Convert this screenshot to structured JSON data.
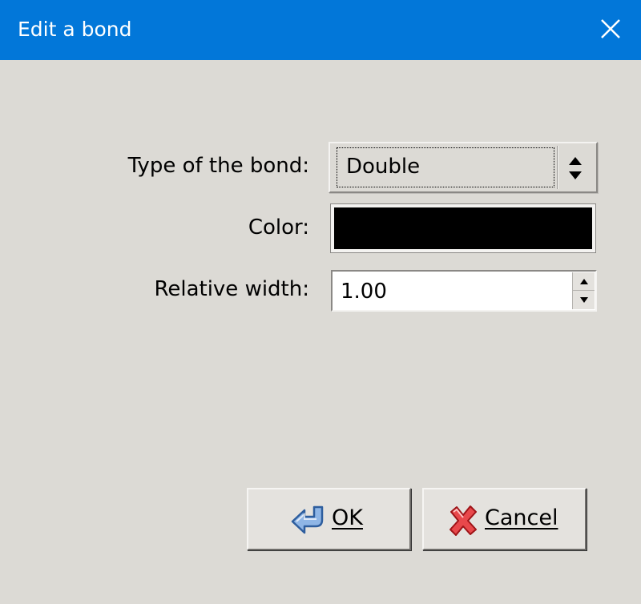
{
  "window": {
    "title": "Edit a bond",
    "close_icon": "close-icon"
  },
  "form": {
    "type_label": "Type of the bond:",
    "type_value": "Double",
    "color_label": "Color:",
    "color_value": "#000000",
    "width_label": "Relative width:",
    "width_value": "1.00"
  },
  "buttons": {
    "ok_label": "OK",
    "ok_icon": "back-arrow-icon",
    "cancel_label": "Cancel",
    "cancel_icon": "red-x-icon"
  },
  "colors": {
    "titlebar": "#0277d9",
    "background": "#dcdad5"
  }
}
